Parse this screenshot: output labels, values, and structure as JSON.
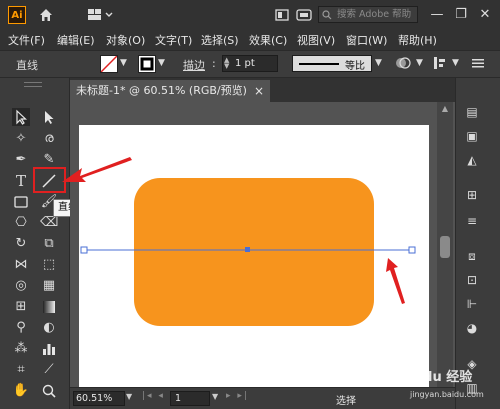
{
  "app": {
    "logo": "Ai"
  },
  "titlebar": {
    "search_placeholder": "搜索 Adobe 帮助",
    "icons": [
      "home-icon",
      "workspace-icon",
      "arrange-icon",
      "search-icon"
    ],
    "window_controls": [
      "minimize",
      "restore",
      "close"
    ]
  },
  "menu": [
    "文件(F)",
    "编辑(E)",
    "对象(O)",
    "文字(T)",
    "选择(S)",
    "效果(C)",
    "视图(V)",
    "窗口(W)",
    "帮助(H)"
  ],
  "controlbar": {
    "selection_label": "直线",
    "stroke_label": "描边",
    "stroke_value": "1 pt",
    "profile_label": "等比"
  },
  "document": {
    "tab_title": "未标题-1* @ 60.51% (RGB/预览)",
    "tab_close": "×"
  },
  "tooltip": {
    "text": "直线段工具 (\\)"
  },
  "statusbar": {
    "zoom": "60.51%",
    "page": "1",
    "tool": "选择"
  },
  "artwork": {
    "rect_fill": "#F7941D",
    "line_color": "#4a6fd6",
    "highlight_color": "#e02020",
    "arrow_color": "#e02020"
  },
  "watermark": {
    "text": "Baidu 经验",
    "subtext": "jingyan.baidu.com"
  }
}
